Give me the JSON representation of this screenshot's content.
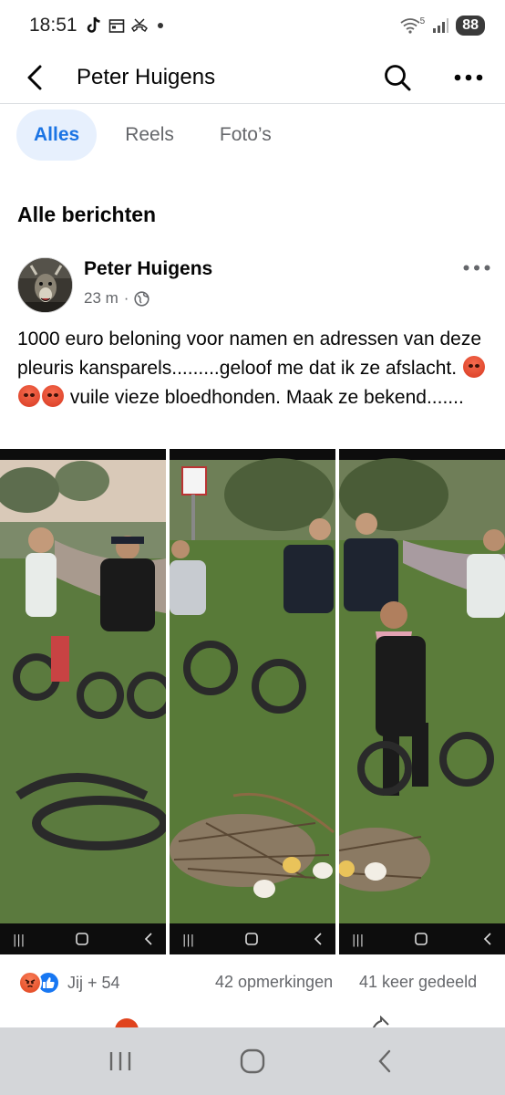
{
  "status_bar": {
    "time": "18:51",
    "battery": "88",
    "network_label": "5"
  },
  "header": {
    "title": "Peter Huigens"
  },
  "tabs": [
    {
      "label": "Alles",
      "active": true
    },
    {
      "label": "Reels",
      "active": false
    },
    {
      "label": "Foto’s",
      "active": false
    }
  ],
  "section": {
    "title": "Alle berichten"
  },
  "post": {
    "author": "Peter Huigens",
    "time": "23 m",
    "visibility_icon": "globe-icon",
    "text_part1": "1000 euro beloning voor namen en adressen van deze pleuris kansparels.........geloof me dat ik ze afslacht.",
    "text_part2": " vuile vieze bloedhonden. Maak ze bekend.......",
    "emojis": [
      "angry-face",
      "angry-face",
      "angry-face"
    ],
    "photo_count": 3,
    "reactions": {
      "icons": [
        "angry",
        "like"
      ],
      "label": "Jij + 54"
    },
    "comments": "42 opmerkingen",
    "shares": "41 keer gedeeld"
  },
  "colors": {
    "accent": "#1b74e4",
    "tab_active_bg": "#e7f0fd",
    "secondary_text": "#65676b",
    "like_blue": "#1877f2",
    "angry_orange": "#e0431d",
    "nav_bar_bg": "#d4d6d9"
  }
}
